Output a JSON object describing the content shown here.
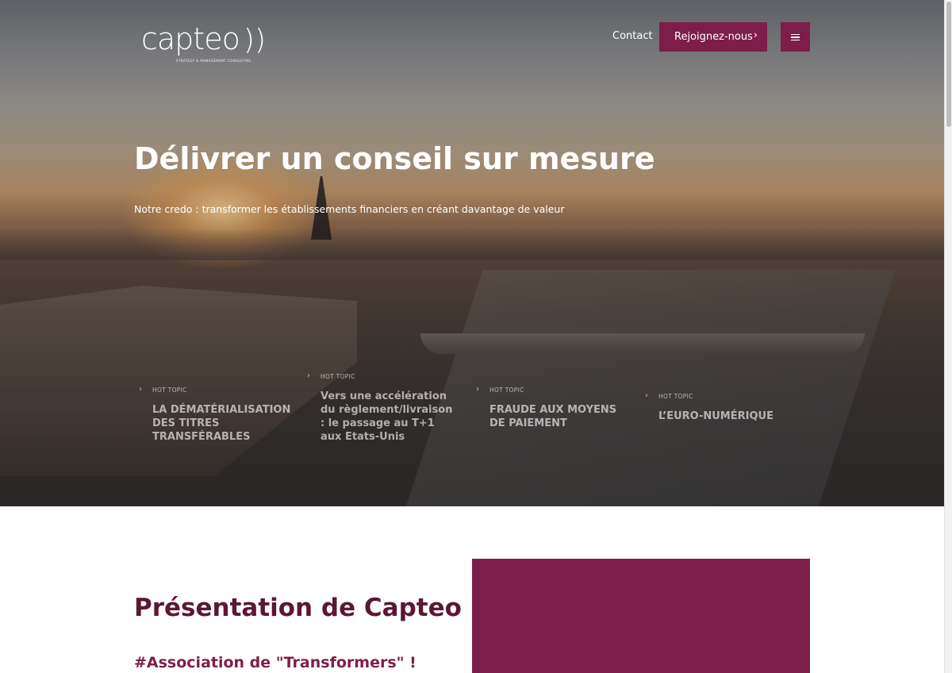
{
  "brand": {
    "logo_word": "capteo",
    "logo_mark": "))",
    "tagline": "STRATEGY & MANAGEMENT CONSULTING",
    "accent_color": "#7d1e4a",
    "title_color": "#5c1735"
  },
  "header": {
    "contact_label": "Contact",
    "join_label": "Rejoignez-nous",
    "join_icon": "chevron-right-icon",
    "menu_icon": "hamburger-menu-icon"
  },
  "hero": {
    "title": "Délivrer un conseil sur mesure",
    "subtitle": "Notre credo : transformer les établissements financiers en créant davantage de valeur"
  },
  "topics": [
    {
      "label": "HOT TOPIC",
      "title": "LA DÉMATÉRIALISATION DES TITRES TRANSFÉRABLES"
    },
    {
      "label": "HOT TOPIC",
      "title": "Vers une accélération du règlement/livraison : le passage au T+1 aux Etats-Unis"
    },
    {
      "label": "HOT TOPIC",
      "title": "FRAUDE AUX MOYENS DE PAIEMENT"
    },
    {
      "label": "HOT TOPIC",
      "title": "L’EURO-NUMÉRIQUE"
    }
  ],
  "presentation": {
    "title": "Présentation de Capteo",
    "subtitle": "#Association de \"Transformers\" !"
  }
}
